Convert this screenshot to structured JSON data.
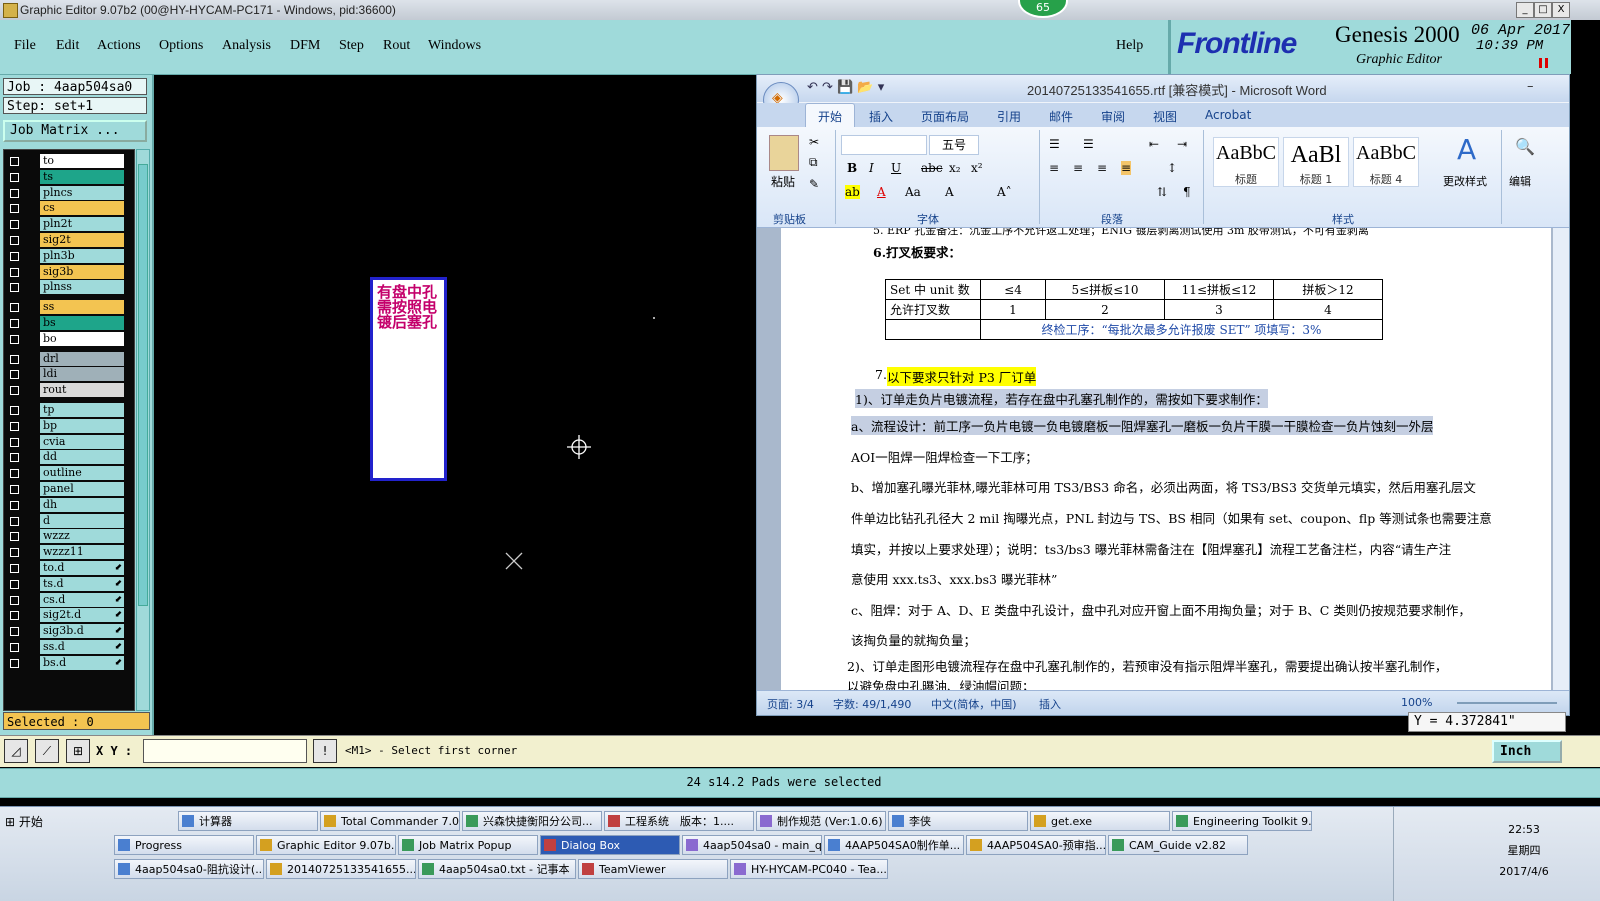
{
  "window": {
    "title": "Graphic Editor 9.07b2 (00@HY-HYCAM-PC171 - Windows, pid:36600)",
    "controls": [
      "_",
      "□",
      "X"
    ]
  },
  "menu": [
    "File",
    "Edit",
    "Actions",
    "Options",
    "Analysis",
    "DFM",
    "Step",
    "Rout",
    "Windows"
  ],
  "help_label": "Help",
  "brand": {
    "logo": "Frontline",
    "product": "Genesis 2000",
    "subtitle": "Graphic Editor",
    "date": "06 Apr 2017",
    "time": "10:39 PM"
  },
  "notification_badge": "65",
  "job": {
    "job_label": "Job : 4aap504sa0",
    "step_label": "Step: set+1",
    "matrix_button": "Job Matrix ..."
  },
  "layers": [
    {
      "name": "to",
      "color": "#ffffff",
      "arrow": ""
    },
    {
      "name": "ts",
      "color": "#1ea58a",
      "arrow": ""
    },
    {
      "name": "plncs",
      "color": "#9fdada",
      "arrow": ""
    },
    {
      "name": "cs",
      "color": "#f3c451",
      "arrow": ""
    },
    {
      "name": "pln2t",
      "color": "#9fdada",
      "arrow": ""
    },
    {
      "name": "sig2t",
      "color": "#f3c451",
      "arrow": ""
    },
    {
      "name": "pln3b",
      "color": "#9fdada",
      "arrow": ""
    },
    {
      "name": "sig3b",
      "color": "#f3c451",
      "arrow": ""
    },
    {
      "name": "plnss",
      "color": "#9fdada",
      "arrow": ""
    },
    {
      "name": "ss",
      "color": "#f3c451",
      "arrow": ""
    },
    {
      "name": "bs",
      "color": "#1ea58a",
      "arrow": ""
    },
    {
      "name": "bo",
      "color": "#ffffff",
      "arrow": ""
    },
    {
      "name": "drl",
      "color": "#9fb0b8",
      "arrow": ""
    },
    {
      "name": "ldi",
      "color": "#9fb0b8",
      "arrow": ""
    },
    {
      "name": "rout",
      "color": "#d9d9d9",
      "arrow": ""
    },
    {
      "name": "tp",
      "color": "#9fdada",
      "arrow": ""
    },
    {
      "name": "bp",
      "color": "#9fdada",
      "arrow": ""
    },
    {
      "name": "cvia",
      "color": "#9fdada",
      "arrow": ""
    },
    {
      "name": "dd",
      "color": "#9fdada",
      "arrow": ""
    },
    {
      "name": "outline",
      "color": "#9fdada",
      "arrow": ""
    },
    {
      "name": "panel",
      "color": "#9fdada",
      "arrow": ""
    },
    {
      "name": "dh",
      "color": "#9fdada",
      "arrow": ""
    },
    {
      "name": "d",
      "color": "#9fdada",
      "arrow": ""
    },
    {
      "name": "wzzz",
      "color": "#9fdada",
      "arrow": ""
    },
    {
      "name": "wzzz11",
      "color": "#9fdada",
      "arrow": ""
    },
    {
      "name": "to.d",
      "color": "#9fdada",
      "arrow": "⬋"
    },
    {
      "name": "ts.d",
      "color": "#9fdada",
      "arrow": "⬋"
    },
    {
      "name": "cs.d",
      "color": "#9fdada",
      "arrow": "⬋"
    },
    {
      "name": "sig2t.d",
      "color": "#9fdada",
      "arrow": "⬋"
    },
    {
      "name": "sig3b.d",
      "color": "#9fdada",
      "arrow": "⬋"
    },
    {
      "name": "ss.d",
      "color": "#9fdada",
      "arrow": "⬋"
    },
    {
      "name": "bs.d",
      "color": "#9fdada",
      "arrow": "⬋"
    }
  ],
  "selected_label": "Selected : 0",
  "canvas_note": "有盘中孔需按照电镀后塞孔",
  "command_bar": {
    "xy_label": "X Y :",
    "xy_value": "",
    "prompt": "<M1> - Select first corner",
    "unit": "Inch",
    "y_readout": "Y = 4.372841\""
  },
  "status_message": "24 s14.2 Pads were selected",
  "word": {
    "title": "20140725133541655.rtf [兼容模式] - Microsoft Word",
    "tabs": [
      "开始",
      "插入",
      "页面布局",
      "引用",
      "邮件",
      "审阅",
      "视图",
      "Acrobat"
    ],
    "font_size": "五号",
    "groups": [
      "剪贴板",
      "字体",
      "段落",
      "样式",
      "编辑"
    ],
    "paste_label": "粘贴",
    "change_styles": "更改样式",
    "edit_label": "编辑",
    "styles": [
      {
        "sample": "AaBbC",
        "label": "标题"
      },
      {
        "sample": "AaBl",
        "label": "标题 1"
      },
      {
        "sample": "AaBbC",
        "label": "标题 4"
      }
    ],
    "doc": {
      "line_top": "5. ERP 孔金备注：沉金工序不允许返工处理；ENIG 镀层剥离测试使用 3m 胶带测试，不可有金剥离",
      "heading6": "6.打叉板要求：",
      "table": [
        [
          "Set 中 unit 数",
          "≤4",
          "5≤拼板≤10",
          "11≤拼板≤12",
          "拼板＞12"
        ],
        [
          "允许打叉数",
          "1",
          "2",
          "3",
          "4"
        ],
        [
          "",
          "终检工序：“每批次最多允许报废 SET” 项填写：3%"
        ]
      ],
      "heading7_num": "7.",
      "heading7": "以下要求只针对 P3 厂订单",
      "p1": "1)、订单走负片电镀流程，若存在盘中孔塞孔制作的，需按如下要求制作：",
      "p2a": "a、流程设计：前工序一负片电镀一负电镀磨板一阻焊塞孔一磨板一负片干膜一干膜检查一负片蚀刻一外层",
      "p2b": "AOI一阻焊一阻焊检查一下工序；",
      "p3a": "b、增加塞孔曝光菲林,曝光菲林可用 TS3/BS3 命名，必须出两面，将 TS3/BS3 交货单元填实，然后用塞孔层文",
      "p3b": "件单边比钻孔孔径大 2 mil 掏曝光点，PNL 封边与 TS、BS 相同（如果有 set、coupon、flp 等测试条也需要注意",
      "p3c": "填实，并按以上要求处理）；说明：ts3/bs3 曝光菲林需备注在【阻焊塞孔】流程工艺备注栏，内容“请生产注",
      "p3d": "意使用 xxx.ts3、xxx.bs3 曝光菲林”",
      "p4a": "c、阻焊：对于 A、D、E 类盘中孔设计，盘中孔对应开窗上面不用掏负量；对于 B、C 类则仍按规范要求制作，",
      "p4b": "该掏负量的就掏负量；",
      "p5a": "2)、订单走图形电镀流程存在盘中孔塞孔制作的，若预审没有指示阻焊半塞孔，需要提出确认按半塞孔制作，",
      "p5b": "以避免盘中孔曝油、绿油帽问题；"
    },
    "status": {
      "page": "页面: 3/4",
      "words": "字数: 49/1,490",
      "lang": "中文(简体，中国)",
      "mode": "插入",
      "zoom": "100%"
    }
  },
  "taskbar": {
    "start": "开始",
    "row1": [
      "Progress",
      "Graphic Editor 9.07b...",
      "Job Matrix Popup",
      "Dialog Box",
      "4aap504sa0 - main_qa",
      "4AAP504SA0制作单...",
      "4AAP504SA0-预审指...",
      "CAM_Guide v2.82"
    ],
    "row0": [
      "计算器",
      "Total Commander 7.0 ...",
      "兴森快捷衡阳分公司...",
      "工程系统　版本：1....",
      "制作规范 (Ver:1.0.6)",
      "李侠",
      "get.exe",
      "Engineering Toolkit 9...."
    ],
    "row2": [
      "4aap504sa0-阻抗设计(...",
      "20140725133541655....",
      "4aap504sa0.txt - 记事本",
      "TeamViewer",
      "HY-HYCAM-PC040 - Tea..."
    ],
    "active_row1": "Dialog Box",
    "clock_time": "22:53",
    "clock_day": "星期四",
    "clock_date": "2017/4/6"
  }
}
